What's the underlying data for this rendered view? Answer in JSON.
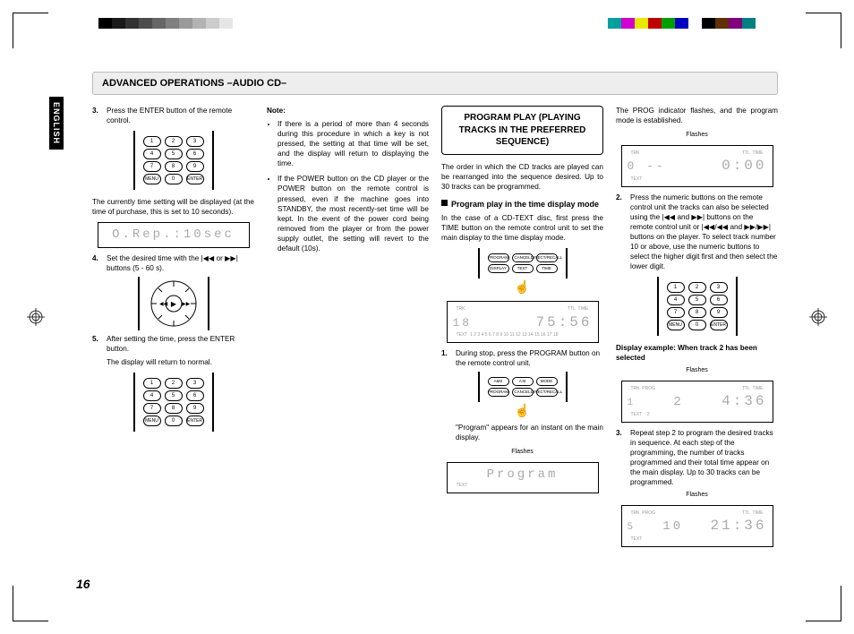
{
  "language_tab": "ENGLISH",
  "page_number": "16",
  "header": "ADVANCED OPERATIONS  –AUDIO CD–",
  "color_swatches_gray": [
    "#000",
    "#1a1a1a",
    "#333",
    "#4d4d4d",
    "#666",
    "#808080",
    "#999",
    "#b3b3b3",
    "#ccc",
    "#e6e6e6",
    "#fff"
  ],
  "color_swatches_color": [
    "#00a0a0",
    "#d000d0",
    "#e8e800",
    "#c00000",
    "#00a000",
    "#0000c0",
    "#ffffff",
    "#000000",
    "#603000",
    "#800080",
    "#008080"
  ],
  "col1": {
    "step3_num": "3.",
    "step3_text": "Press the ENTER button of the remote control.",
    "keypad_menu": "MENU",
    "keypad_enter": "ENTER",
    "para_after_keypad": "The currently time setting will be displayed (at the time of purchase, this is set to 10 seconds).",
    "lcd1": "O.Rep.:10sec",
    "step4_num": "4.",
    "step4_text": "Set the desired time with the |◀◀ or ▶▶| buttons (5 - 60 s).",
    "step5_num": "5.",
    "step5_text": "After setting the time, press the ENTER button.",
    "step5_sub": "The display will return to normal."
  },
  "col2": {
    "note_label": "Note:",
    "note1": "If there is a period of more than 4 seconds during this procedure in which a key is not pressed, the setting at that time will be set, and the display will return to displaying the time.",
    "note2": "If the POWER button on the CD player or the POWER button on the remote control is pressed, even if the machine goes into STANDBY, the most recently-set time will be kept. In the event of the power cord being removed from the player or from the power supply outlet, the setting will revert to the default (10s)."
  },
  "col3": {
    "section_title": "PROGRAM PLAY (PLAYING TRACKS IN THE PREFERRED SEQUENCE)",
    "intro": "The order in which the CD tracks are played can be rearranged into the sequence desired. Up to 30 tracks can be programmed.",
    "subhead": "Program play in the time display mode",
    "sub_intro": "In the case of a CD-TEXT disc, first press the TIME button on the remote control unit to set the main display to the time display mode.",
    "remote_btns1": [
      "PROGRAM",
      "CANCEL",
      "DIRECT/RECALL",
      "DISPLAY",
      "TEXT",
      "TIME"
    ],
    "lcd_track": "18",
    "lcd_time": "75:56",
    "lcd_ticks": "1  2  3  4  5  6  7  8  9 10 11 12 13 14 15 16 17 18",
    "step1_num": "1.",
    "step1_text": "During stop, press the PROGRAM button on the remote control unit.",
    "remote_btns2": [
      "AMS",
      "A-B",
      "MODE",
      "PROGRAM",
      "CANCEL",
      "DIRECT/RECALL"
    ],
    "step1_sub": "\"Program\" appears for an instant on the main display.",
    "flashes_label": "Flashes",
    "lcd_program": "Program"
  },
  "col4": {
    "top_para": "The PROG indicator flashes, and the program mode is established.",
    "flashes": "Flashes",
    "lcd1_track": "0 --",
    "lcd1_time": "0:00",
    "step2_num": "2.",
    "step2_text": "Press the numeric buttons on the remote control unit the tracks can also be selected using the |◀◀ and ▶▶| buttons on the remote control unit or |◀◀/◀◀ and ▶▶/▶▶| buttons on the player. To select track number 10 or above, use the numeric buttons to select the higher digit first and then select the lower digit.",
    "example_label": "Display example: When track 2 has been selected",
    "lcd2_left": "1",
    "lcd2_track": "2",
    "lcd2_time": "4:36",
    "lcd2_text_row": "2",
    "step3_num": "3.",
    "step3_text": "Repeat step 2 to program the desired tracks in sequence. At each step of the programming, the number of tracks programmed and their total time appear on the main display. Up to 30 tracks can be programmed.",
    "lcd3_left": "5",
    "lcd3_track": "10",
    "lcd3_time": "21:36"
  },
  "lcd_labels": {
    "trk": "TRK",
    "ttl": "TTL",
    "time": "TIME",
    "prog": "PROG",
    "text": "TEXT"
  }
}
